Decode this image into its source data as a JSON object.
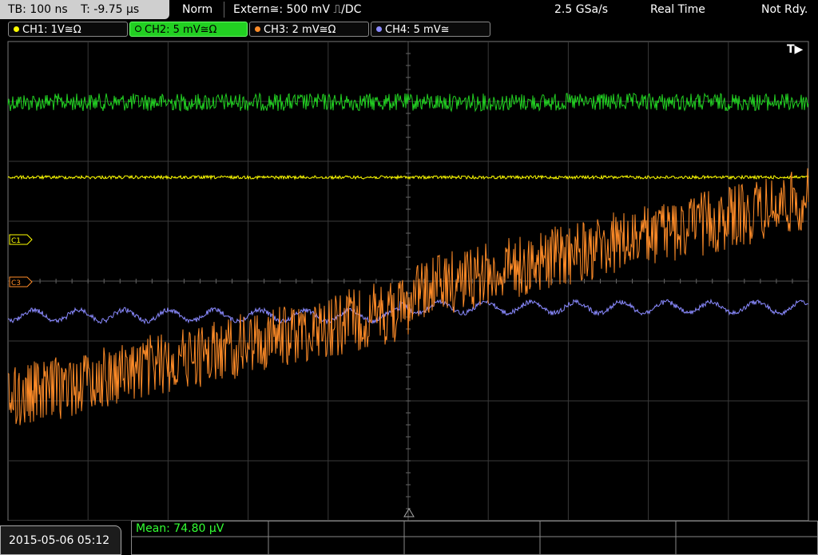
{
  "status_bar": {
    "timebase": "TB: 100 ns",
    "trigger_time": "T: -9.75 µs",
    "acq_mode": "Norm",
    "trigger": "Extern≅: 500 mV ⎍/DC",
    "sample_rate": "2.5 GSa/s",
    "real_time": "Real Time",
    "state": "Not Rdy."
  },
  "channels": [
    {
      "label": "CH1: 1V≅Ω",
      "color": "#ffff00"
    },
    {
      "label": "CH2: 5 mV≅Ω",
      "color": "#22d022"
    },
    {
      "label": "CH3: 2 mV≅Ω",
      "color": "#ff8c28"
    },
    {
      "label": "CH4: 5 mV≅",
      "color": "#8a8aff"
    }
  ],
  "markers": {
    "c1": "C1",
    "c3": "C3",
    "trigger_label": "T▶"
  },
  "footer": {
    "timestamp": "2015-05-06 05:12",
    "measurement": "Mean: 74.80 µV"
  }
}
